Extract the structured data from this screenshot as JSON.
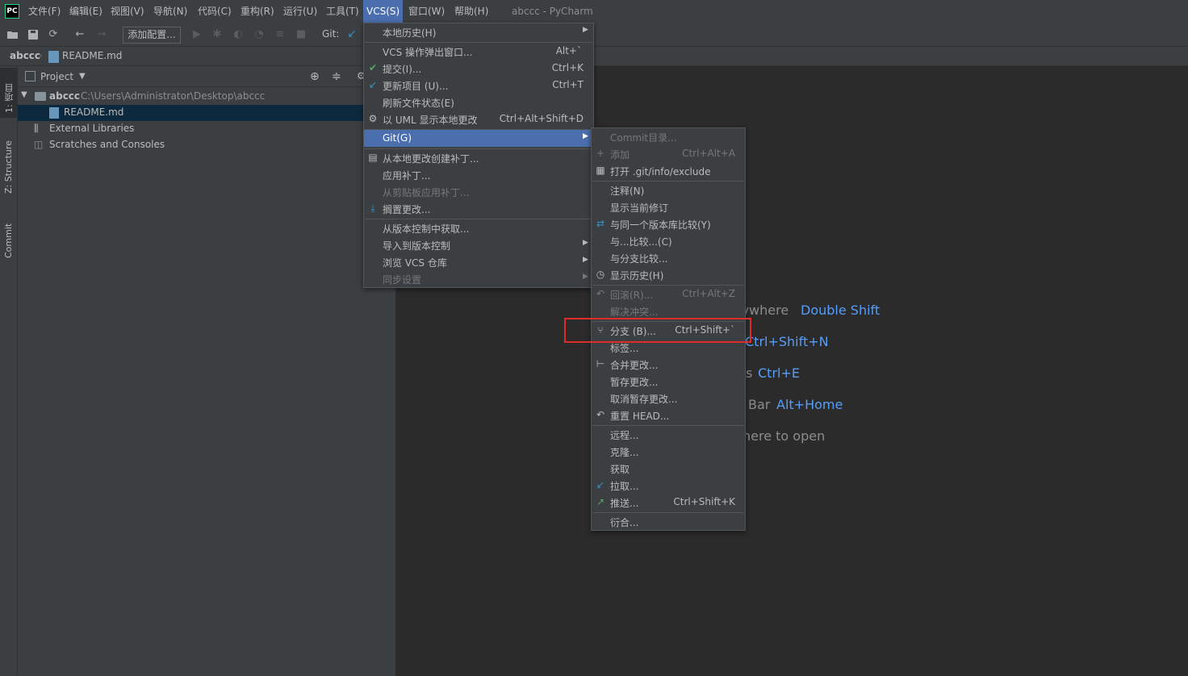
{
  "app": {
    "logo_text": "PC",
    "window_title": "abccc - PyCharm"
  },
  "menubar": {
    "items": [
      "文件(F)",
      "编辑(E)",
      "视图(V)",
      "导航(N)",
      "代码(C)",
      "重构(R)",
      "运行(U)",
      "工具(T)",
      "VCS(S)",
      "窗口(W)",
      "帮助(H)"
    ],
    "active": "VCS(S)"
  },
  "toolbar": {
    "add_config_label": "添加配置...",
    "git_label": "Git:"
  },
  "breadcrumb": {
    "project": "abccc",
    "file": "README.md"
  },
  "tool_strip": {
    "project": "1: 项目",
    "structure": "Z: Structure",
    "commit": "Commit"
  },
  "project_panel": {
    "title": "Project",
    "root": {
      "name": "abccc",
      "path": "C:\\Users\\Administrator\\Desktop\\abccc"
    },
    "file": "README.md",
    "external_libraries": "External Libraries",
    "scratches": "Scratches and Consoles"
  },
  "editor_hints": [
    {
      "text": "rywhere",
      "key": "Double Shift"
    },
    {
      "text": "",
      "key": "Ctrl+Shift+N"
    },
    {
      "text": "s",
      "key": "Ctrl+E"
    },
    {
      "text": "Bar",
      "key": "Alt+Home"
    },
    {
      "text": "here to open",
      "key": ""
    }
  ],
  "vcs_menu": {
    "local_history": "本地历史(H)",
    "vcs_popup": "VCS 操作弹出窗口...",
    "vcs_popup_shortcut": "Alt+`",
    "commit": "提交(I)...",
    "commit_shortcut": "Ctrl+K",
    "update": "更新项目 (U)...",
    "update_shortcut": "Ctrl+T",
    "refresh": "刷新文件状态(E)",
    "uml": "以 UML 显示本地更改",
    "uml_shortcut": "Ctrl+Alt+Shift+D",
    "git": "Git(G)",
    "create_patch": "从本地更改创建补丁...",
    "apply_patch": "应用补丁...",
    "apply_clipboard_patch": "从剪贴板应用补丁...",
    "shelve": "搁置更改...",
    "get_from_vcs": "从版本控制中获取...",
    "import_vcs": "导入到版本控制",
    "browse_vcs": "浏览 VCS 仓库",
    "sync_settings": "同步设置"
  },
  "git_menu": {
    "commit_dir": "Commit目录...",
    "add": "添加",
    "add_shortcut": "Ctrl+Alt+A",
    "open_exclude": "打开 .git/info/exclude",
    "annotate": "注释(N)",
    "show_revision": "显示当前修订",
    "compare_same": "与同一个版本库比较(Y)",
    "compare_with": "与...比较...(C)",
    "compare_branch": "与分支比较...",
    "show_history": "显示历史(H)",
    "rollback": "回滚(R)...",
    "rollback_shortcut": "Ctrl+Alt+Z",
    "resolve_conflicts": "解决冲突...",
    "branches": "分支 (B)...",
    "branches_shortcut": "Ctrl+Shift+`",
    "tag": "标签...",
    "merge": "合并更改...",
    "stash": "暂存更改...",
    "unstash": "取消暂存更改...",
    "reset_head": "重置 HEAD...",
    "remotes": "远程...",
    "clone": "克隆...",
    "fetch": "获取",
    "pull": "拉取...",
    "push": "推送...",
    "push_shortcut": "Ctrl+Shift+K",
    "rebase": "衍合..."
  },
  "colors": {
    "accent": "#4b6eaf",
    "highlight_box": "#e02b2b",
    "key_hint": "#589df6"
  }
}
